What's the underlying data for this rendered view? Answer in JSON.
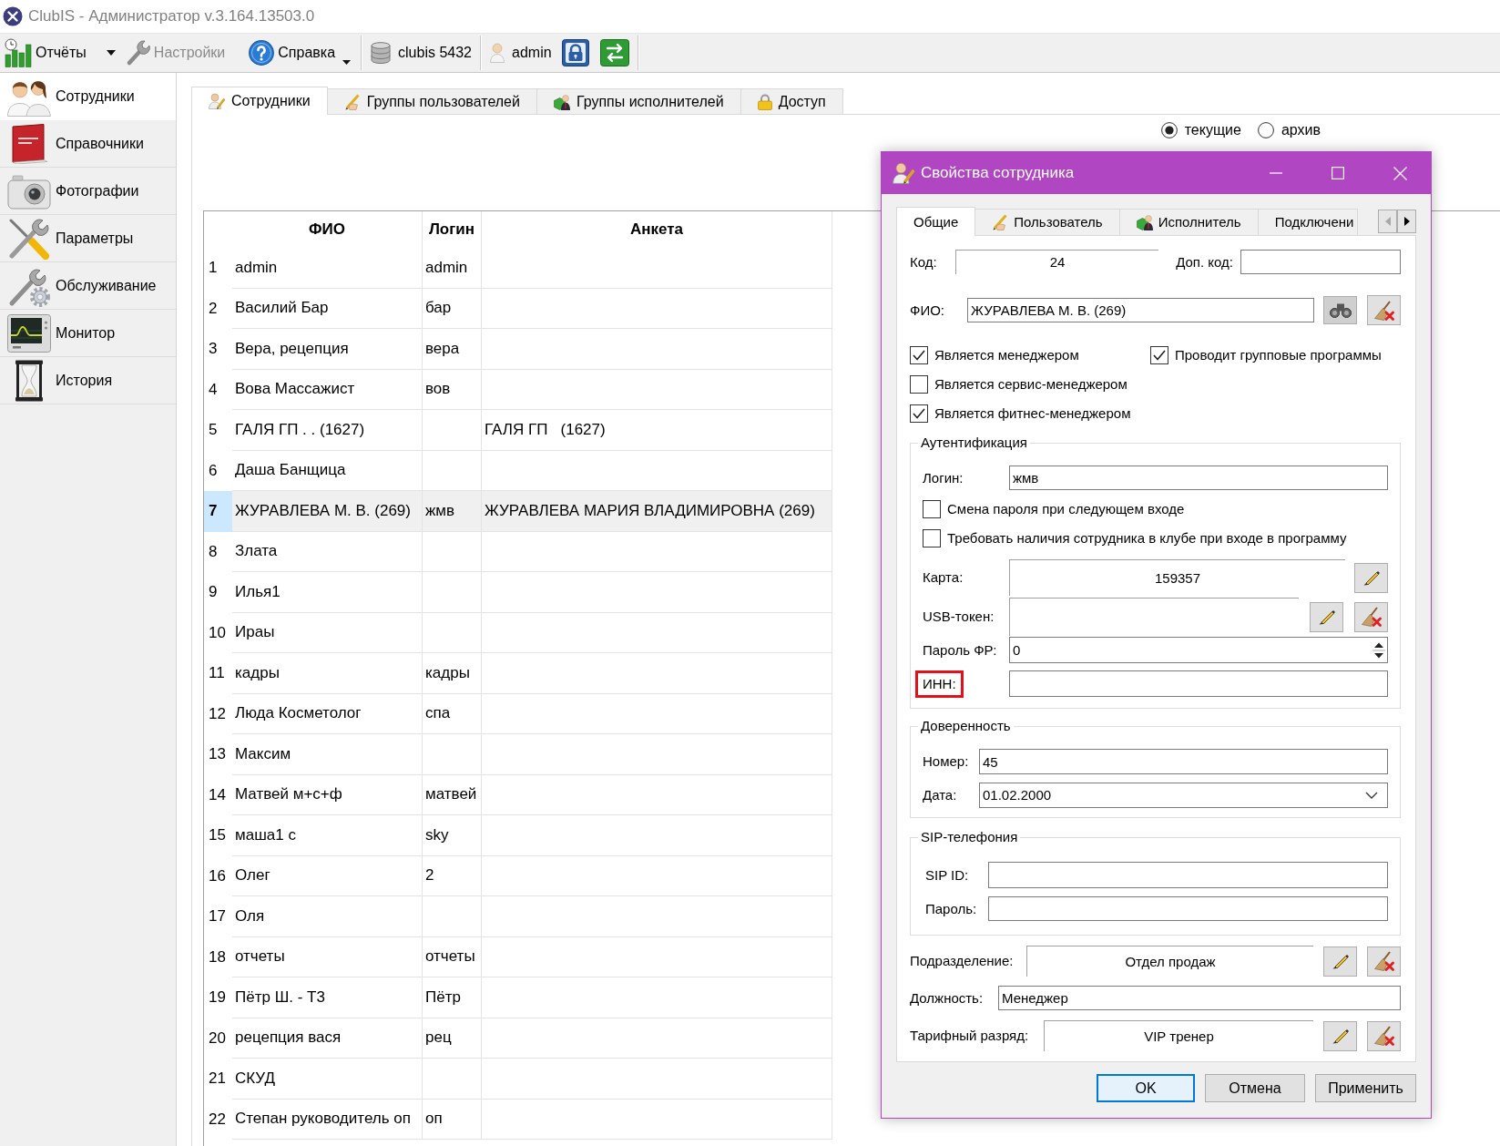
{
  "window": {
    "title": "ClubIS - Администратор v.3.164.13503.0"
  },
  "toolbar": [
    {
      "kind": "split",
      "label": "Отчёты",
      "disabled": false
    },
    {
      "kind": "button",
      "label": "Настройки",
      "disabled": true
    },
    {
      "kind": "menu",
      "label": "Справка",
      "disabled": false
    },
    {
      "kind": "info",
      "label": "clubis 5432",
      "disabled": false
    },
    {
      "kind": "info",
      "label": "admin",
      "disabled": false
    }
  ],
  "sidebar": {
    "items": [
      {
        "label": "Сотрудники",
        "selected": true
      },
      {
        "label": "Справочники",
        "selected": false
      },
      {
        "label": "Фотографии",
        "selected": false
      },
      {
        "label": "Параметры",
        "selected": false
      },
      {
        "label": "Обслуживание",
        "selected": false
      },
      {
        "label": "Монитор",
        "selected": false
      },
      {
        "label": "История",
        "selected": false
      }
    ]
  },
  "tabs": [
    {
      "label": "Сотрудники",
      "selected": true
    },
    {
      "label": "Группы пользователей",
      "selected": false
    },
    {
      "label": "Группы исполнителей",
      "selected": false
    },
    {
      "label": "Доступ",
      "selected": false
    }
  ],
  "filter": [
    {
      "label": "текущие",
      "selected": true
    },
    {
      "label": "архив",
      "selected": false
    }
  ],
  "table": {
    "columns": [
      "ФИО",
      "Логин",
      "Анкета"
    ],
    "rows": [
      {
        "number": "1",
        "fio": "admin",
        "login": "admin",
        "selected": false
      },
      {
        "number": "2",
        "fio": "Василий Бар",
        "login": "бар",
        "selected": false
      },
      {
        "number": "3",
        "fio": "Вера, рецепция",
        "login": "вера",
        "selected": false
      },
      {
        "number": "4",
        "fio": "Вова Массажист",
        "login": "вов",
        "selected": false
      },
      {
        "number": "5",
        "fio": "ГАЛЯ ГП . . (1627)",
        "anketa": "ГАЛЯ ГП   (1627)",
        "selected": false
      },
      {
        "number": "6",
        "fio": "Даша Банщица",
        "selected": false
      },
      {
        "number": "7",
        "fio": "ЖУРАВЛЕВА М. В. (269)",
        "login": "жмв",
        "anketa": "ЖУРАВЛЕВА МАРИЯ ВЛАДИМИРОВНА (269)",
        "selected": true
      },
      {
        "number": "8",
        "fio": "Злата",
        "selected": false
      },
      {
        "number": "9",
        "fio": "Илья1",
        "selected": false
      },
      {
        "number": "10",
        "fio": "Ираы",
        "selected": false
      },
      {
        "number": "11",
        "fio": "кадры",
        "login": "кадры",
        "selected": false
      },
      {
        "number": "12",
        "fio": "Люда Косметолог",
        "login": "спа",
        "selected": false
      },
      {
        "number": "13",
        "fio": "Максим",
        "selected": false
      },
      {
        "number": "14",
        "fio": "Матвей м+с+ф",
        "login": "матвей",
        "selected": false
      },
      {
        "number": "15",
        "fio": "маша1 с",
        "login": "sky",
        "selected": false
      },
      {
        "number": "16",
        "fio": "Олег",
        "login": "2",
        "selected": false
      },
      {
        "number": "17",
        "fio": "Оля",
        "selected": false
      },
      {
        "number": "18",
        "fio": "отчеты",
        "login": "отчеты",
        "selected": false
      },
      {
        "number": "19",
        "fio": "Пётр Ш. - Т3",
        "login": "Пётр",
        "selected": false
      },
      {
        "number": "20",
        "fio": "рецепция вася",
        "login": "рец",
        "selected": false
      },
      {
        "number": "21",
        "fio": "СКУД",
        "selected": false
      },
      {
        "number": "22",
        "fio": "Степан руководитель оп",
        "login": "оп",
        "selected": false
      }
    ]
  },
  "dialog": {
    "title": "Свойства сотрудника",
    "tabs": [
      {
        "label": "Общие",
        "selected": true
      },
      {
        "label": "Пользователь",
        "selected": false
      },
      {
        "label": "Исполнитель",
        "selected": false
      },
      {
        "label": "Подключени",
        "selected": false
      }
    ],
    "code": {
      "label": "Код:",
      "value": "24"
    },
    "extra_code": {
      "label": "Доп. код:"
    },
    "full_name": {
      "label": "ФИО:",
      "value": "ЖУРАВЛЕВА М. В. (269)"
    },
    "roles": [
      {
        "label": "Является менеджером",
        "checked": true
      },
      {
        "label": "Проводит групповые программы",
        "checked": true
      },
      {
        "label": "Является сервис-менеджером",
        "checked": false
      },
      {
        "label": "Является фитнес-менеджером",
        "checked": true
      }
    ],
    "authentication": {
      "title": "Аутентификация",
      "login": {
        "label": "Логин:",
        "value": "жмв"
      },
      "options": [
        {
          "label": "Смена пароля при следующем входе",
          "checked": false
        },
        {
          "label": "Требовать наличия сотрудника в клубе при входе в программу",
          "checked": false
        }
      ],
      "card": {
        "label": "Карта:",
        "value": "159357"
      },
      "usb_token": {
        "label": "USB-токен:"
      },
      "fr_password": {
        "label": "Пароль ФР:",
        "value": "0"
      },
      "inn": {
        "label": "ИНН:",
        "highlighted": true
      }
    },
    "power_of_attorney": {
      "title": "Доверенность",
      "number": {
        "label": "Номер:",
        "value": "45"
      },
      "date": {
        "label": "Дата:",
        "value": "01.02.2000"
      }
    },
    "sip": {
      "title": "SIP-телефония",
      "sip_id": {
        "label": "SIP ID:"
      },
      "password": {
        "label": "Пароль:"
      }
    },
    "department": {
      "label": "Подразделение:",
      "value": "Отдел продаж"
    },
    "position": {
      "label": "Должность:",
      "value": "Менеджер"
    },
    "tariff_grade": {
      "label": "Тарифный разряд:",
      "value": "VIP тренер"
    },
    "buttons": [
      {
        "label": "OK",
        "default": true
      },
      {
        "label": "Отмена",
        "default": false
      },
      {
        "label": "Применить",
        "default": false
      }
    ]
  }
}
